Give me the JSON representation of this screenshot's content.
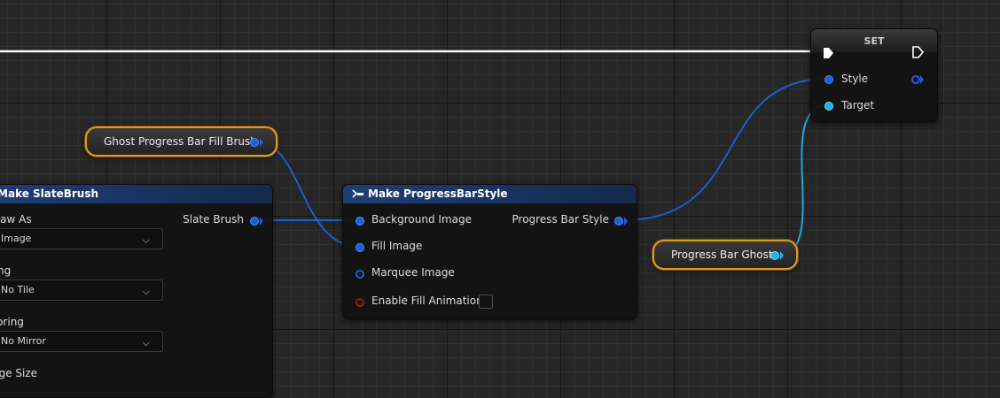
{
  "set_node": {
    "title": "SET",
    "pins": {
      "style": "Style",
      "target": "Target"
    }
  },
  "var_fill_brush": {
    "label": "Ghost Progress Bar Fill Brush"
  },
  "var_progress_bar": {
    "label": "Progress Bar Ghost"
  },
  "make_slatebrush": {
    "title": "Make SlateBrush",
    "output": "Slate Brush",
    "fields": [
      {
        "label": "Draw As",
        "value": "Image"
      },
      {
        "label": "Tiling",
        "value": "No Tile"
      },
      {
        "label": "Mirroring",
        "value": "No Mirror"
      },
      {
        "label": "Image Size"
      }
    ]
  },
  "make_progressbarstyle": {
    "title": "Make ProgressBarStyle",
    "inputs": {
      "background": "Background Image",
      "fill": "Fill Image",
      "marquee": "Marquee Image",
      "animation": "Enable Fill Animation"
    },
    "output": "Progress Bar Style"
  },
  "colors": {
    "struct_pin": "#1e5fd8",
    "object_pin": "#1fb3ec",
    "bool_pin": "#a81010",
    "variable_border": "#e09a1a",
    "header": "#1f3e74"
  }
}
